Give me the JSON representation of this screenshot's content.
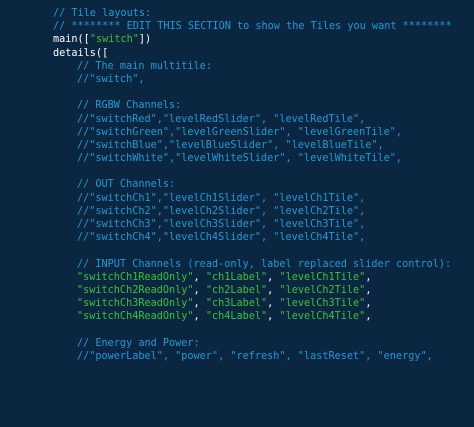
{
  "code_lines": [
    {
      "indent": 0,
      "tokens": [
        {
          "k": "comment",
          "t": "// Tile layouts:"
        }
      ]
    },
    {
      "indent": 0,
      "tokens": [
        {
          "k": "comment",
          "t": "// ******** EDIT THIS SECTION to show the Tiles you want ********"
        }
      ]
    },
    {
      "indent": 0,
      "tokens": [
        {
          "k": "ident",
          "t": "main(["
        },
        {
          "k": "string",
          "t": "\"switch\""
        },
        {
          "k": "ident",
          "t": "])"
        }
      ]
    },
    {
      "indent": 0,
      "tokens": [
        {
          "k": "ident",
          "t": "details(["
        }
      ]
    },
    {
      "indent": 1,
      "tokens": [
        {
          "k": "comment",
          "t": "// The main multitile:"
        }
      ]
    },
    {
      "indent": 1,
      "tokens": [
        {
          "k": "comment",
          "t": "//\"switch\","
        }
      ]
    },
    {
      "indent": 1,
      "tokens": []
    },
    {
      "indent": 1,
      "tokens": [
        {
          "k": "comment",
          "t": "// RGBW Channels:"
        }
      ]
    },
    {
      "indent": 1,
      "tokens": [
        {
          "k": "comment",
          "t": "//\"switchRed\",\"levelRedSlider\", \"levelRedTile\","
        }
      ]
    },
    {
      "indent": 1,
      "tokens": [
        {
          "k": "comment",
          "t": "//\"switchGreen\",\"levelGreenSlider\", \"levelGreenTile\","
        }
      ]
    },
    {
      "indent": 1,
      "tokens": [
        {
          "k": "comment",
          "t": "//\"switchBlue\",\"levelBlueSlider\", \"levelBlueTile\","
        }
      ]
    },
    {
      "indent": 1,
      "tokens": [
        {
          "k": "comment",
          "t": "//\"switchWhite\",\"levelWhiteSlider\", \"levelWhiteTile\","
        }
      ]
    },
    {
      "indent": 1,
      "tokens": []
    },
    {
      "indent": 1,
      "tokens": [
        {
          "k": "comment",
          "t": "// OUT Channels:"
        }
      ]
    },
    {
      "indent": 1,
      "tokens": [
        {
          "k": "comment",
          "t": "//\"switchCh1\",\"levelCh1Slider\", \"levelCh1Tile\","
        }
      ]
    },
    {
      "indent": 1,
      "tokens": [
        {
          "k": "comment",
          "t": "//\"switchCh2\",\"levelCh2Slider\", \"levelCh2Tile\","
        }
      ]
    },
    {
      "indent": 1,
      "tokens": [
        {
          "k": "comment",
          "t": "//\"switchCh3\",\"levelCh3Slider\", \"levelCh3Tile\","
        }
      ]
    },
    {
      "indent": 1,
      "tokens": [
        {
          "k": "comment",
          "t": "//\"switchCh4\",\"levelCh4Slider\", \"levelCh4Tile\","
        }
      ]
    },
    {
      "indent": 1,
      "tokens": []
    },
    {
      "indent": 1,
      "tokens": [
        {
          "k": "comment",
          "t": "// INPUT Channels (read-only, label replaced slider control):"
        }
      ]
    },
    {
      "indent": 1,
      "tokens": [
        {
          "k": "string",
          "t": "\"switchCh1ReadOnly\""
        },
        {
          "k": "ident",
          "t": ", "
        },
        {
          "k": "string",
          "t": "\"ch1Label\""
        },
        {
          "k": "ident",
          "t": ", "
        },
        {
          "k": "string",
          "t": "\"levelCh1Tile\""
        },
        {
          "k": "ident",
          "t": ","
        }
      ]
    },
    {
      "indent": 1,
      "tokens": [
        {
          "k": "string",
          "t": "\"switchCh2ReadOnly\""
        },
        {
          "k": "ident",
          "t": ", "
        },
        {
          "k": "string",
          "t": "\"ch2Label\""
        },
        {
          "k": "ident",
          "t": ", "
        },
        {
          "k": "string",
          "t": "\"levelCh2Tile\""
        },
        {
          "k": "ident",
          "t": ","
        }
      ]
    },
    {
      "indent": 1,
      "tokens": [
        {
          "k": "string",
          "t": "\"switchCh3ReadOnly\""
        },
        {
          "k": "ident",
          "t": ", "
        },
        {
          "k": "string",
          "t": "\"ch3Label\""
        },
        {
          "k": "ident",
          "t": ", "
        },
        {
          "k": "string",
          "t": "\"levelCh3Tile\""
        },
        {
          "k": "ident",
          "t": ","
        }
      ]
    },
    {
      "indent": 1,
      "tokens": [
        {
          "k": "string",
          "t": "\"switchCh4ReadOnly\""
        },
        {
          "k": "ident",
          "t": ", "
        },
        {
          "k": "string",
          "t": "\"ch4Label\""
        },
        {
          "k": "ident",
          "t": ", "
        },
        {
          "k": "string",
          "t": "\"levelCh4Tile\""
        },
        {
          "k": "ident",
          "t": ","
        }
      ]
    },
    {
      "indent": 1,
      "tokens": []
    },
    {
      "indent": 1,
      "tokens": [
        {
          "k": "comment",
          "t": "// Energy and Power:"
        }
      ]
    },
    {
      "indent": 1,
      "tokens": [
        {
          "k": "comment",
          "t": "//\"powerLabel\", \"power\", \"refresh\", \"lastReset\", \"energy\","
        }
      ]
    }
  ],
  "colors": {
    "background": "#0b2640",
    "comment": "#1e9bd8",
    "identifier": "#ffffff",
    "string": "#3ac23a"
  }
}
